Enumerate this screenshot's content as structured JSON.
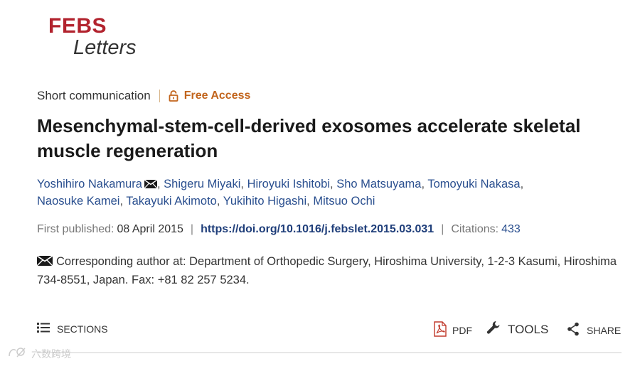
{
  "journal": {
    "logo_top": "FEBS",
    "logo_bottom": "Letters",
    "brand_color": "#b2232e"
  },
  "article": {
    "type": "Short communication",
    "access": "Free Access",
    "title": "Mesenchymal-stem-cell-derived exosomes accelerate skeletal muscle regeneration",
    "authors": [
      "Yoshihiro Nakamura",
      "Shigeru Miyaki",
      "Hiroyuki Ishitobi",
      "Sho Matsuyama",
      "Tomoyuki Nakasa",
      "Naosuke Kamei",
      "Takayuki Akimoto",
      "Yukihito Higashi",
      "Mitsuo Ochi"
    ],
    "author_separator": ",",
    "first_published_label": "First published:",
    "first_published_date": "08 April 2015",
    "doi": "https://doi.org/10.1016/j.febslet.2015.03.031",
    "citations_label": "Citations:",
    "citations_count": "433",
    "separator": "|",
    "corresponding": "Corresponding author at: Department of Orthopedic Surgery, Hiroshima University, 1-2-3 Kasumi, Hiroshima 734-8551, Japan. Fax: +81 82 257 5234."
  },
  "toolbar": {
    "sections_label": "SECTIONS",
    "pdf_label": "PDF",
    "tools_label": "TOOLS",
    "share_label": "SHARE"
  },
  "watermark": {
    "text": "六数跨境"
  },
  "icons": [
    "lock-icon",
    "mail-icon",
    "list-icon",
    "pdf-icon",
    "wrench-icon",
    "share-icon"
  ]
}
